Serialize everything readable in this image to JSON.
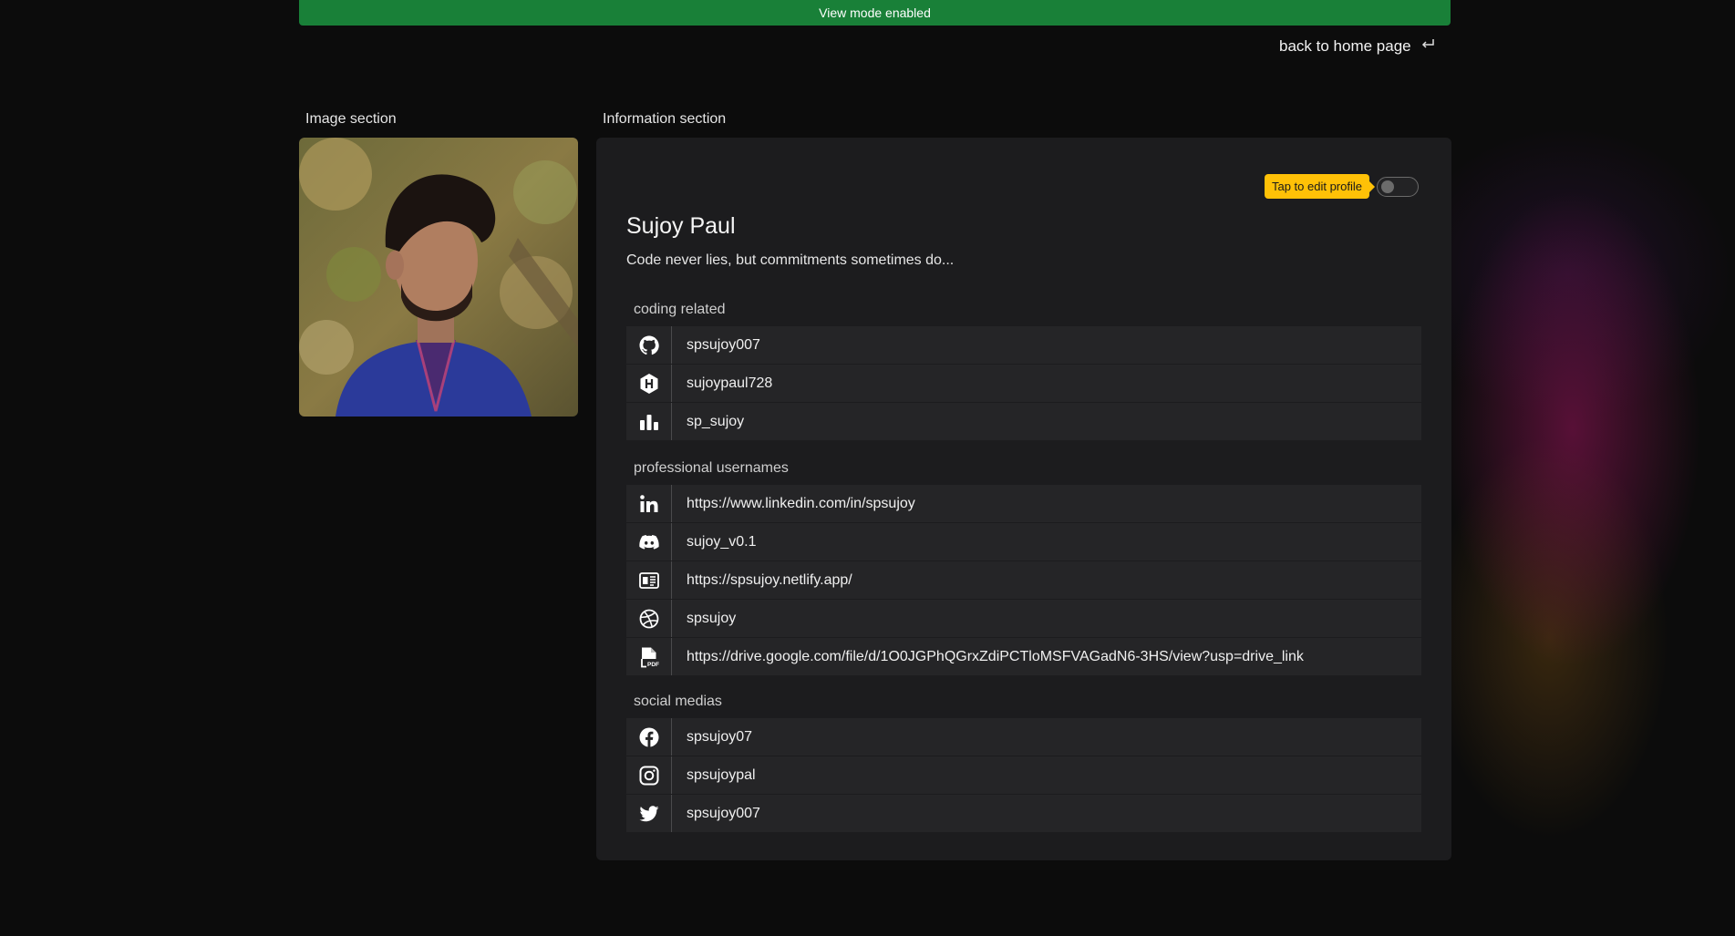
{
  "banner": {
    "text": "View mode enabled",
    "color": "#198038"
  },
  "nav": {
    "back_label": "back to home page",
    "back_icon": "return-arrow-icon"
  },
  "image_section": {
    "title": "Image section"
  },
  "info_section": {
    "title": "Information section",
    "edit_tooltip": "Tap to edit profile",
    "edit_toggle": {
      "on": false
    },
    "name": "Sujoy Paul",
    "bio": "Code never lies, but commitments sometimes do..."
  },
  "groups": [
    {
      "title": "coding related",
      "items": [
        {
          "icon": "github-icon",
          "value": "spsujoy007"
        },
        {
          "icon": "hackerrank-icon",
          "value": "sujoypaul728"
        },
        {
          "icon": "codeforces-icon",
          "value": "sp_sujoy"
        }
      ]
    },
    {
      "title": "professional usernames",
      "items": [
        {
          "icon": "linkedin-icon",
          "value": "https://www.linkedin.com/in/spsujoy"
        },
        {
          "icon": "discord-icon",
          "value": "sujoy_v0.1"
        },
        {
          "icon": "portfolio-icon",
          "value": "https://spsujoy.netlify.app/"
        },
        {
          "icon": "dribbble-icon",
          "value": "spsujoy"
        },
        {
          "icon": "pdf-file-icon",
          "value": "https://drive.google.com/file/d/1O0JGPhQGrxZdiPCTloMSFVAGadN6-3HS/view?usp=drive_link"
        }
      ]
    },
    {
      "title": "social medias",
      "items": [
        {
          "icon": "facebook-icon",
          "value": "spsujoy07"
        },
        {
          "icon": "instagram-icon",
          "value": "spsujoypal"
        },
        {
          "icon": "twitter-icon",
          "value": "spsujoy007"
        }
      ]
    }
  ]
}
